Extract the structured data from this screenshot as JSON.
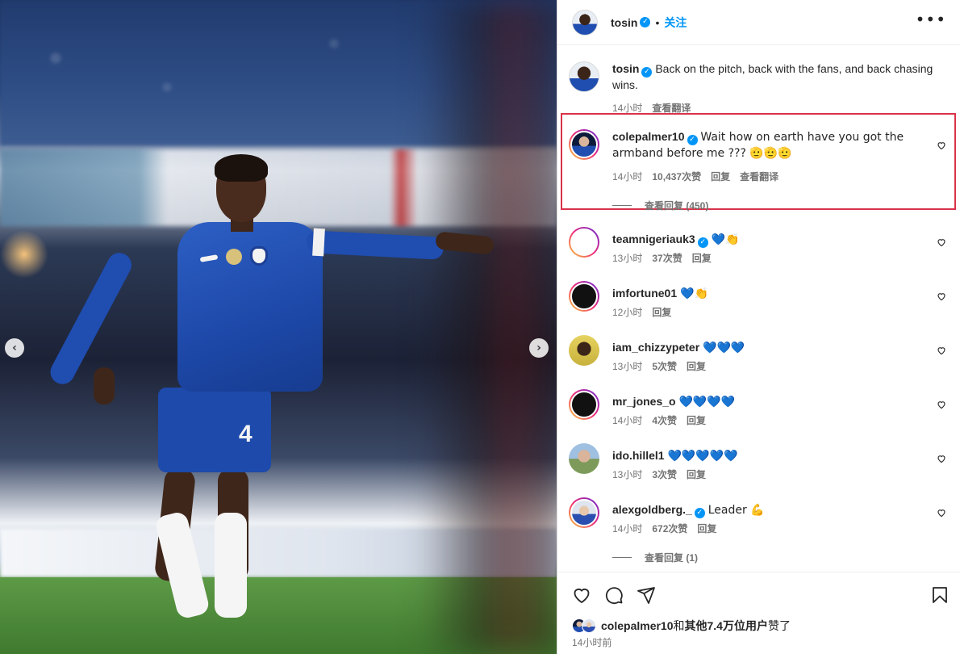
{
  "post": {
    "author": "tosin",
    "follow_label": "关注",
    "more_label": "•••",
    "caption": "Back on the pitch, back with the fans, and back chasing wins.",
    "caption_time": "14小时",
    "caption_translate": "查看翻译",
    "player_number": "4"
  },
  "carousel": {
    "prev_label": "‹",
    "next_label": "›"
  },
  "comments": [
    {
      "user": "colepalmer10",
      "verified": true,
      "text": "Wait how on earth have you got the armband before me ??? 🫡🫡🫡",
      "time": "14小时",
      "likes": "10,437次赞",
      "reply": "回复",
      "translate": "查看翻译",
      "view_replies": "查看回复 (450)"
    },
    {
      "user": "teamnigeriauk3",
      "verified": true,
      "text": "💙👏",
      "time": "13小时",
      "likes": "37次赞",
      "reply": "回复"
    },
    {
      "user": "imfortune01",
      "verified": false,
      "text": "💙👏",
      "time": "12小时",
      "reply": "回复"
    },
    {
      "user": "iam_chizzypeter",
      "verified": false,
      "text": "💙💙💙",
      "time": "13小时",
      "likes": "5次赞",
      "reply": "回复"
    },
    {
      "user": "mr_jones_o",
      "verified": false,
      "text": "💙💙💙💙",
      "time": "14小时",
      "likes": "4次赞",
      "reply": "回复"
    },
    {
      "user": "ido.hillel1",
      "verified": false,
      "text": "💙💙💙💙💙",
      "time": "13小时",
      "likes": "3次赞",
      "reply": "回复"
    },
    {
      "user": "alexgoldberg._",
      "verified": true,
      "text": "Leader 💪",
      "time": "14小时",
      "likes": "672次赞",
      "reply": "回复",
      "view_replies": "查看回复 (1)"
    }
  ],
  "footer": {
    "liked_by_user": "colepalmer10",
    "liked_by_conj": "和",
    "liked_by_others": "其他7.4万位用户",
    "liked_by_suffix": "赞了",
    "posted_time": "14小时前"
  },
  "icons": {
    "like": "heart-icon",
    "comment": "comment-icon",
    "share": "send-icon",
    "save": "bookmark-icon",
    "verified": "verified-badge-icon"
  },
  "colors": {
    "accent": "#0095f6",
    "highlight_border": "#d9334a",
    "meta_text": "#737373"
  }
}
